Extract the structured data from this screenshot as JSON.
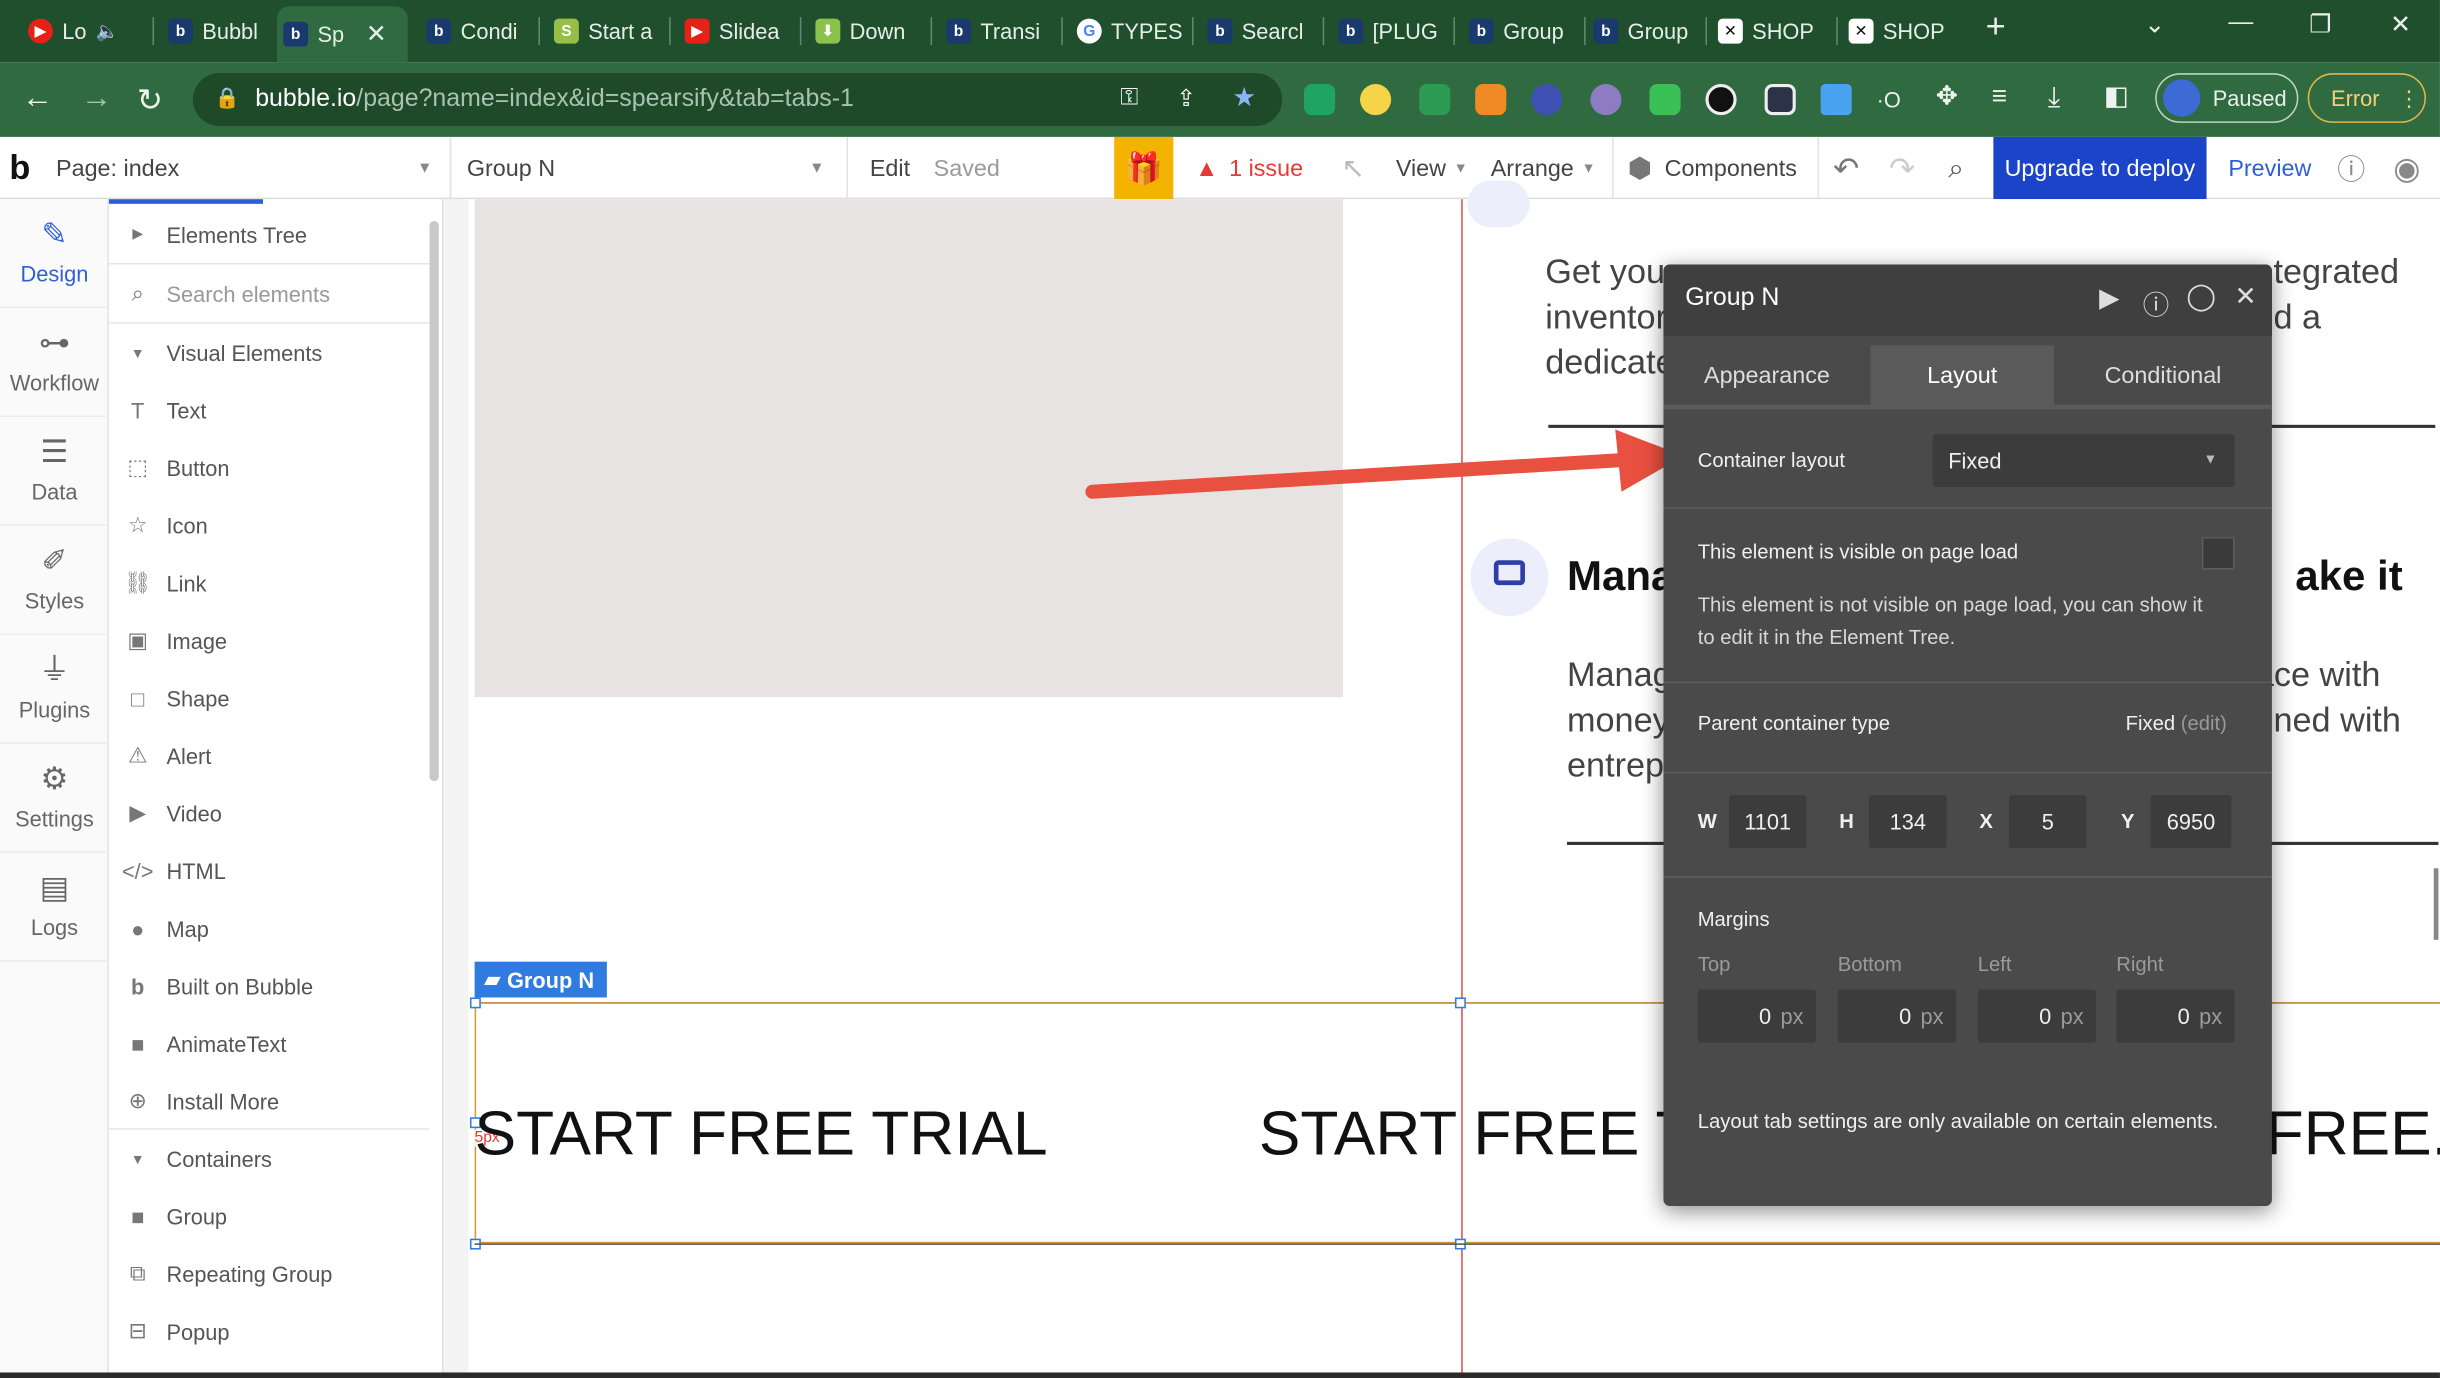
{
  "browser": {
    "tabs": [
      {
        "label": "Lo",
        "favicon": "youtube-icon",
        "color": "#e62117"
      },
      {
        "label": "Bubbl",
        "favicon": "bubble-icon",
        "color": "#1a3a6e"
      },
      {
        "label": "Sp",
        "favicon": "bubble-icon",
        "color": "#1a3a6e"
      },
      {
        "label": "Condi",
        "favicon": "bubble-icon",
        "color": "#1a3a6e"
      },
      {
        "label": "Start a",
        "favicon": "shopify-icon",
        "color": "#96bf48"
      },
      {
        "label": "Slidea",
        "favicon": "youtube-icon",
        "color": "#e62117"
      },
      {
        "label": "Down",
        "favicon": "download-icon",
        "color": "#8bc34a"
      },
      {
        "label": "Transi",
        "favicon": "bubble-icon",
        "color": "#1a3a6e"
      },
      {
        "label": "TYPES",
        "favicon": "google-icon",
        "color": "#ffffff"
      },
      {
        "label": "Searcl",
        "favicon": "bubble-icon",
        "color": "#1a3a6e"
      },
      {
        "label": "[PLUG",
        "favicon": "bubble-icon",
        "color": "#1a3a6e"
      },
      {
        "label": "Group",
        "favicon": "bubble-icon",
        "color": "#1a3a6e"
      },
      {
        "label": "Group",
        "favicon": "bubble-icon",
        "color": "#1a3a6e"
      },
      {
        "label": "SHOP",
        "favicon": "x-icon",
        "color": "#ffffff"
      },
      {
        "label": "SHOP",
        "favicon": "x-icon",
        "color": "#ffffff"
      }
    ],
    "url_domain": "bubble.io",
    "url_path": "/page?name=index&id=spearsify&tab=tabs-1",
    "profile_label": "Paused",
    "error_label": "Error"
  },
  "toolbar": {
    "page_label": "Page: index",
    "element_select": "Group N",
    "edit_label": "Edit",
    "saved_label": "Saved",
    "issue_label": "1 issue",
    "view_label": "View",
    "arrange_label": "Arrange",
    "components_label": "Components",
    "upgrade_label": "Upgrade to deploy",
    "preview_label": "Preview"
  },
  "leftnav": [
    {
      "label": "Design",
      "icon": "design-icon"
    },
    {
      "label": "Workflow",
      "icon": "workflow-icon"
    },
    {
      "label": "Data",
      "icon": "data-icon"
    },
    {
      "label": "Styles",
      "icon": "styles-icon"
    },
    {
      "label": "Plugins",
      "icon": "plugins-icon"
    },
    {
      "label": "Settings",
      "icon": "settings-icon"
    },
    {
      "label": "Logs",
      "icon": "logs-icon"
    }
  ],
  "palette": {
    "elements_tree": "Elements Tree",
    "search_placeholder": "Search elements",
    "visual_header": "Visual Elements",
    "visual_items": [
      {
        "label": "Text",
        "icon": "text-icon"
      },
      {
        "label": "Button",
        "icon": "button-icon"
      },
      {
        "label": "Icon",
        "icon": "star-icon"
      },
      {
        "label": "Link",
        "icon": "link-icon"
      },
      {
        "label": "Image",
        "icon": "image-icon"
      },
      {
        "label": "Shape",
        "icon": "shape-icon"
      },
      {
        "label": "Alert",
        "icon": "alert-icon"
      },
      {
        "label": "Video",
        "icon": "video-icon"
      },
      {
        "label": "HTML",
        "icon": "html-icon"
      },
      {
        "label": "Map",
        "icon": "map-icon"
      },
      {
        "label": "Built on Bubble",
        "icon": "bubble-icon"
      },
      {
        "label": "AnimateText",
        "icon": "plugin-icon"
      },
      {
        "label": "Install More",
        "icon": "plus-circle-icon"
      }
    ],
    "containers_header": "Containers",
    "container_items": [
      {
        "label": "Group",
        "icon": "group-icon"
      },
      {
        "label": "Repeating Group",
        "icon": "repeating-group-icon"
      },
      {
        "label": "Popup",
        "icon": "popup-icon"
      }
    ]
  },
  "canvas": {
    "right_text_top": [
      "Get you",
      "inventor",
      "dedicate"
    ],
    "right_text_top_end": [
      "tegrated",
      "d a"
    ],
    "manage_heading": "Mana",
    "manage_heading_end": "ake it",
    "manage_text": [
      "Manag",
      "money",
      "entrep"
    ],
    "manage_text_end": [
      "ace with",
      "ned with"
    ],
    "group_tag": "Group N",
    "marker_label": "5px",
    "trial_text_1": "START FREE TRIAL",
    "trial_text_2": "START FREE T",
    "trial_text_3": "FREE..."
  },
  "property_editor": {
    "title": "Group N",
    "tabs": [
      "Appearance",
      "Layout",
      "Conditional"
    ],
    "active_tab": "Layout",
    "container_layout_label": "Container layout",
    "container_layout_value": "Fixed",
    "visible_label": "This element is visible on page load",
    "visible_note": "This element is not visible on page load, you can show it to edit it in the Element Tree.",
    "parent_label": "Parent container type",
    "parent_value": "Fixed",
    "parent_edit": "(edit)",
    "dims": {
      "w_label": "W",
      "w": "1101",
      "h_label": "H",
      "h": "134",
      "x_label": "X",
      "x": "5",
      "y_label": "Y",
      "y": "6950"
    },
    "margins_label": "Margins",
    "margins": [
      {
        "label": "Top",
        "value": "0"
      },
      {
        "label": "Bottom",
        "value": "0"
      },
      {
        "label": "Left",
        "value": "0"
      },
      {
        "label": "Right",
        "value": "0"
      }
    ],
    "unit": "px",
    "footer_note": "Layout tab settings are only available on certain elements."
  },
  "colors": {
    "accent_blue": "#2f5fd6",
    "upgrade_blue": "#1b44c8",
    "annotation_arrow": "#e8503f",
    "gift_yellow": "#f5b301",
    "issue_red": "#e53935"
  }
}
